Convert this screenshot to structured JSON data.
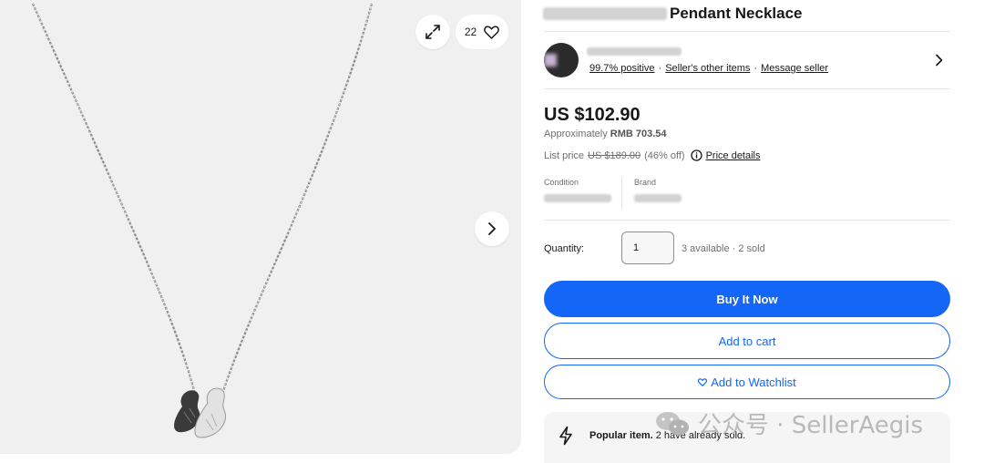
{
  "gallery": {
    "watch_count": "22",
    "icons": {
      "expand": "expand-icon",
      "heart": "heart-icon",
      "next": "chevron-right-icon"
    }
  },
  "listing": {
    "title_visible": "Pendant Necklace"
  },
  "seller": {
    "feedback_link": "99.7% positive",
    "other_items_link": "Seller's other items",
    "message_link": "Message seller",
    "separator": "·"
  },
  "price": {
    "main": "US $102.90",
    "approx_prefix": "Approximately",
    "approx_value": "RMB 703.54",
    "list_label": "List price",
    "list_value": "US $189.00",
    "discount": "(46% off)",
    "details_link": "Price details"
  },
  "specs": {
    "condition_label": "Condition",
    "brand_label": "Brand"
  },
  "quantity": {
    "label": "Quantity:",
    "value": "1",
    "availability": "3 available · 2 sold"
  },
  "actions": {
    "buy_now": "Buy It Now",
    "add_to_cart": "Add to cart",
    "add_to_watchlist": "Add to Watchlist"
  },
  "popular": {
    "bold": "Popular item.",
    "text": "2 have already sold."
  },
  "watermark": {
    "text": "公众号 · SellerAegis"
  },
  "colors": {
    "accent": "#1466f7",
    "text": "#191919",
    "muted": "#707070",
    "gallery_bg": "#f0f0f0"
  }
}
